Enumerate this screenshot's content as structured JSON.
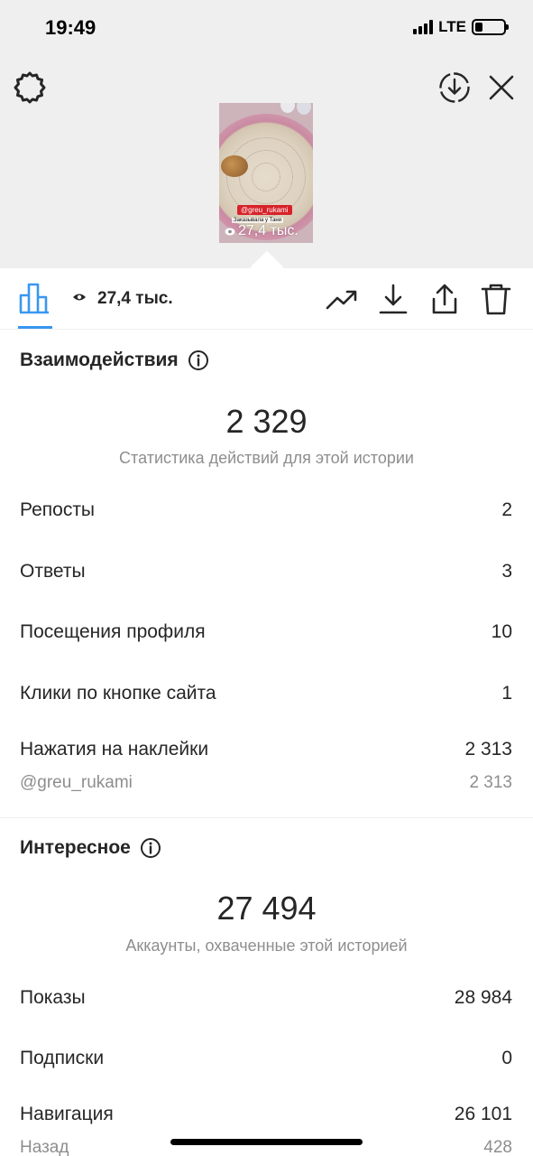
{
  "status_bar": {
    "time": "19:49",
    "network": "LTE",
    "battery_level": 0.25
  },
  "preview": {
    "sticker_tag": "@greu_rukami",
    "caption": "Заказывала у Тани",
    "views": "27,4 тыс."
  },
  "tabbar": {
    "views": "27,4 тыс."
  },
  "interactions": {
    "title": "Взаимодействия",
    "total": "2 329",
    "subtitle": "Статистика действий для этой истории",
    "rows": [
      {
        "label": "Репосты",
        "value": "2"
      },
      {
        "label": "Ответы",
        "value": "3"
      },
      {
        "label": "Посещения профиля",
        "value": "10"
      },
      {
        "label": "Клики по кнопке сайта",
        "value": "1"
      },
      {
        "label": "Нажатия на наклейки",
        "value": "2 313"
      }
    ],
    "sub_row": {
      "label": "@greu_rukami",
      "value": "2 313"
    }
  },
  "discovery": {
    "title": "Интересное",
    "total": "27 494",
    "subtitle": "Аккаунты, охваченные этой историей",
    "rows": [
      {
        "label": "Показы",
        "value": "28 984"
      },
      {
        "label": "Подписки",
        "value": "0"
      },
      {
        "label": "Навигация",
        "value": "26 101"
      }
    ],
    "sub_row": {
      "label": "Назад",
      "value": "428"
    }
  },
  "colors": {
    "accent": "#3897f0",
    "text": "#262626",
    "muted": "#8e8e8e",
    "header_bg": "#efefef",
    "tag_red": "#d8222a"
  },
  "icons": [
    "settings-icon",
    "download-circle-icon",
    "close-icon",
    "bar-chart-icon",
    "eye-icon",
    "trending-icon",
    "download-icon",
    "share-icon",
    "trash-icon",
    "info-icon"
  ]
}
